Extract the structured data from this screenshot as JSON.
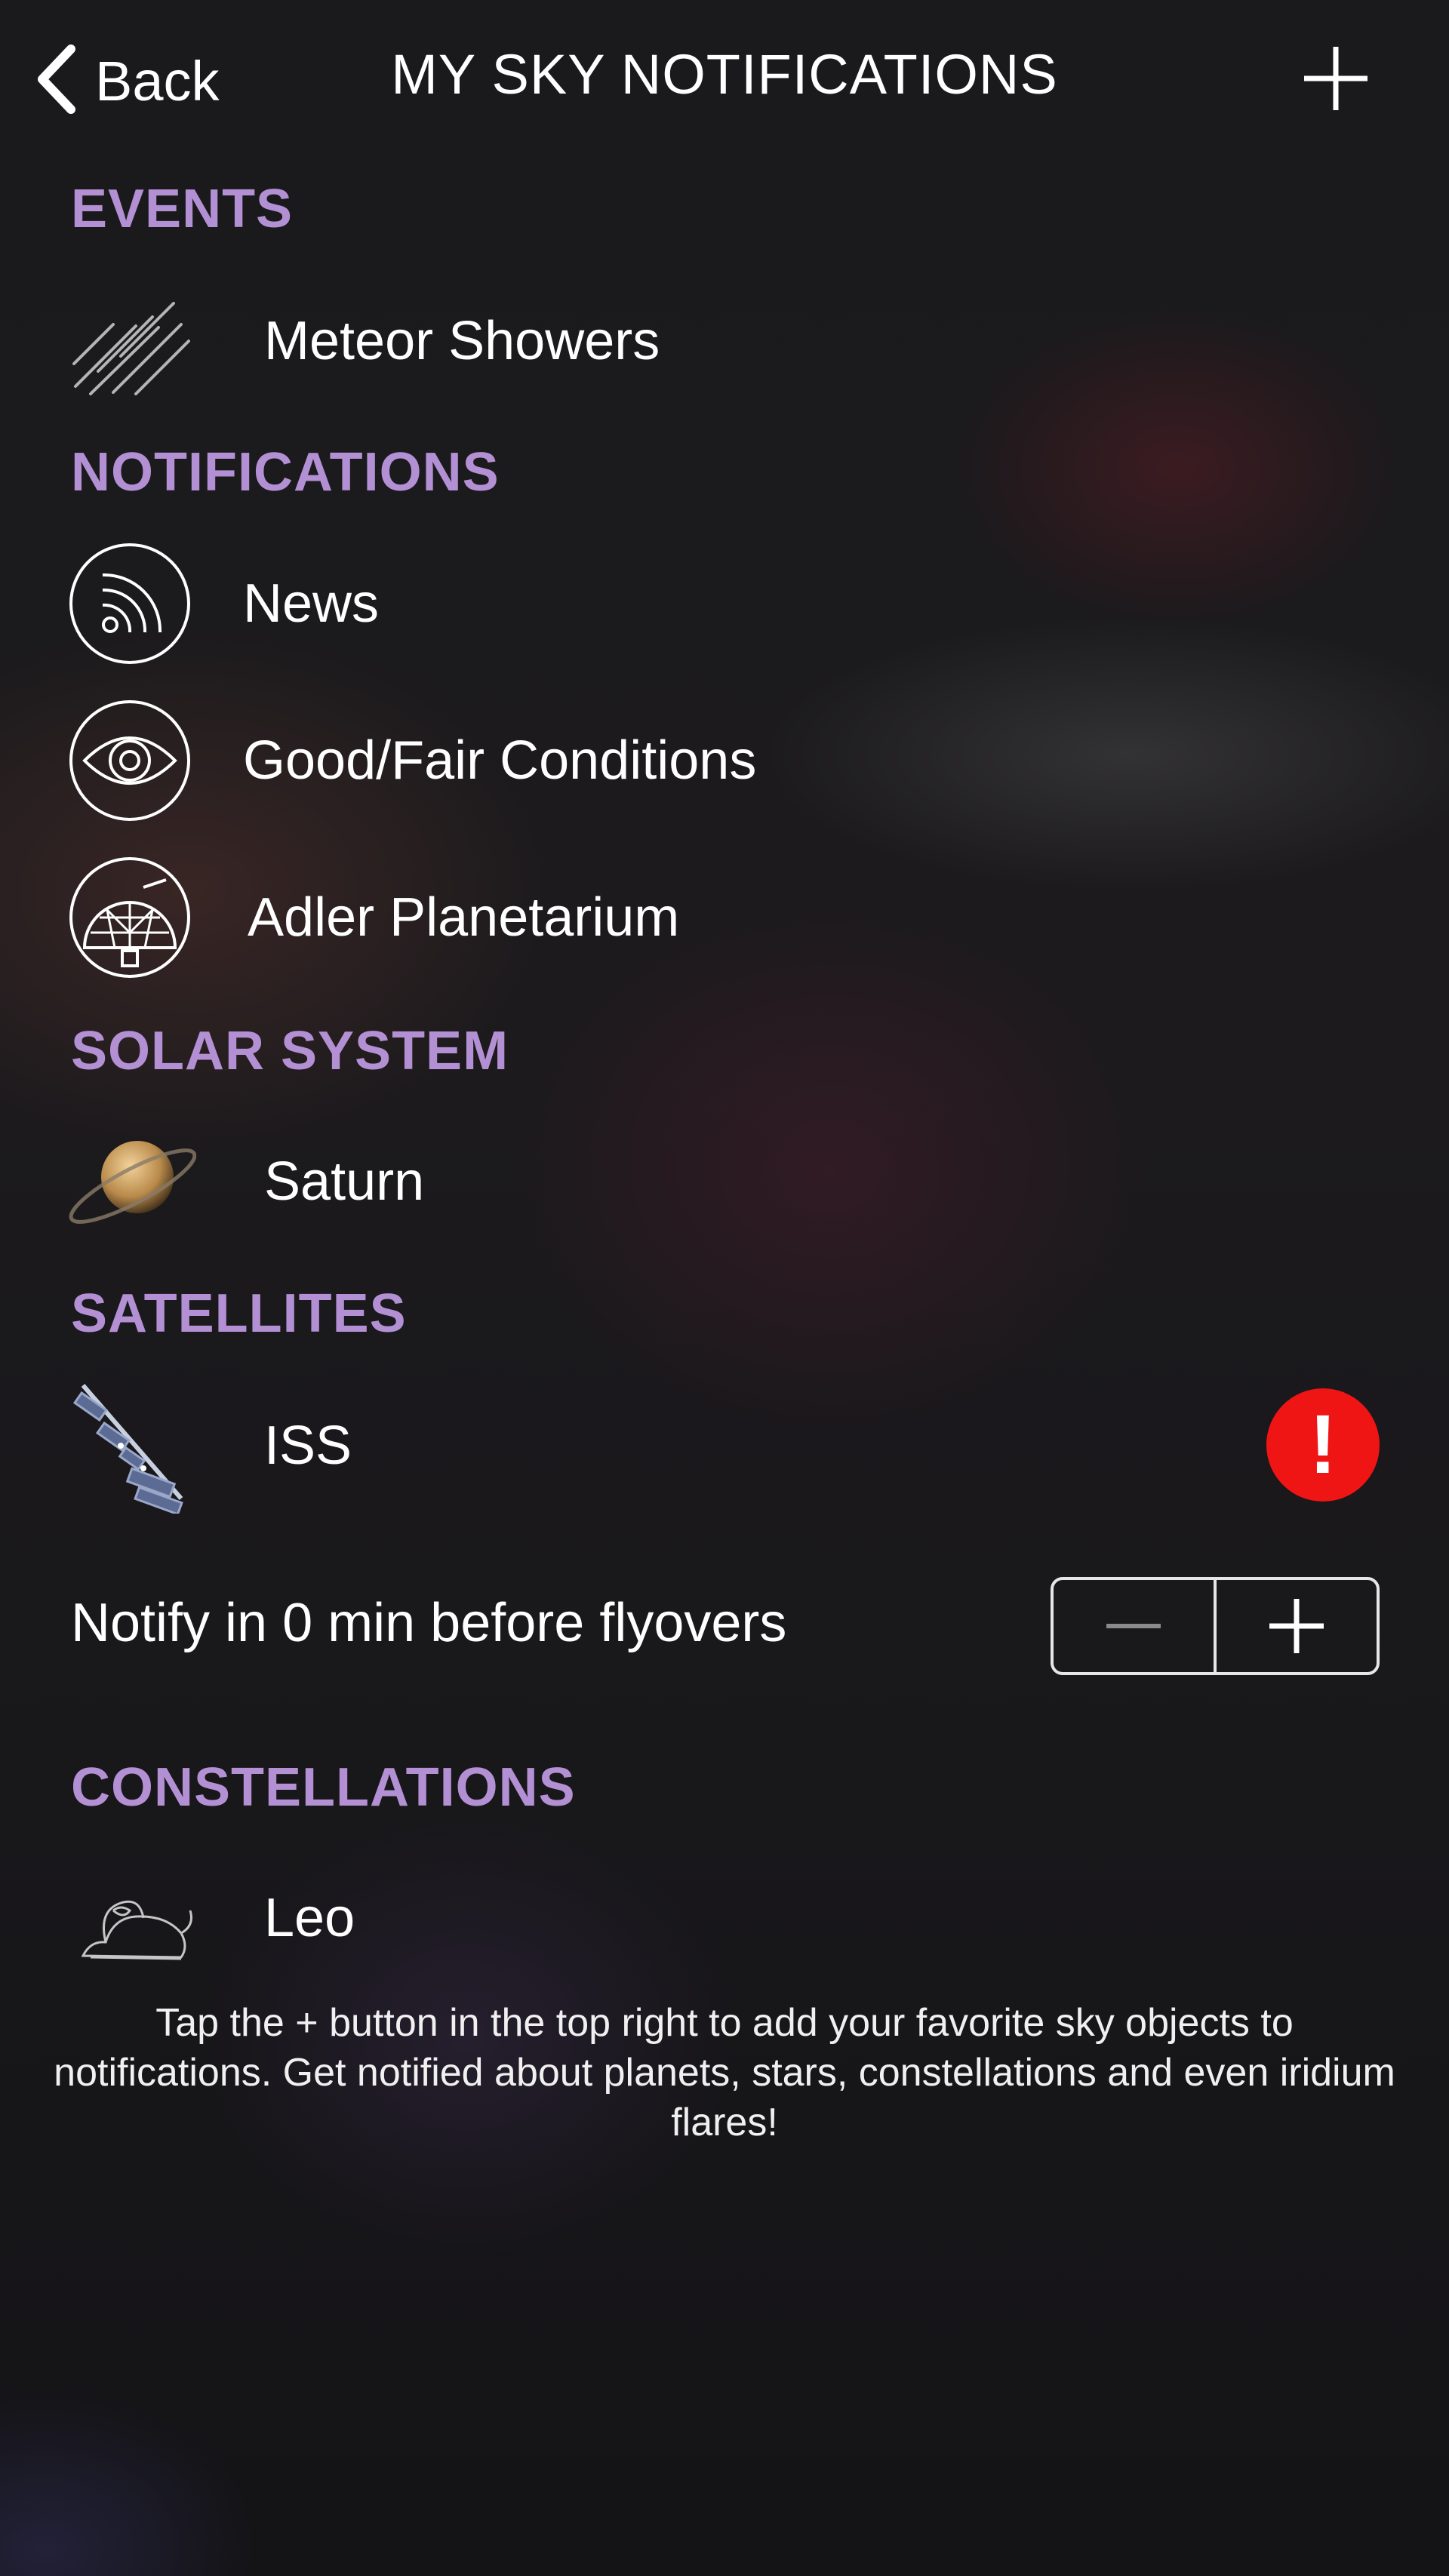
{
  "header": {
    "back_label": "Back",
    "title": "MY SKY NOTIFICATIONS",
    "add_icon": "plus-icon"
  },
  "sections": {
    "events": {
      "heading": "EVENTS",
      "items": [
        {
          "label": "Meteor Showers",
          "icon": "meteor-showers-icon"
        }
      ]
    },
    "notifications": {
      "heading": "NOTIFICATIONS",
      "items": [
        {
          "label": "News",
          "icon": "rss-icon"
        },
        {
          "label": "Good/Fair Conditions",
          "icon": "eye-icon"
        },
        {
          "label": "Adler Planetarium",
          "icon": "planetarium-dome-icon"
        }
      ]
    },
    "solar_system": {
      "heading": "SOLAR SYSTEM",
      "items": [
        {
          "label": "Saturn",
          "icon": "saturn-icon"
        }
      ]
    },
    "satellites": {
      "heading": "SATELLITES",
      "items": [
        {
          "label": "ISS",
          "icon": "iss-icon",
          "alert": "!"
        }
      ]
    },
    "constellations": {
      "heading": "CONSTELLATIONS",
      "items": [
        {
          "label": "Leo",
          "icon": "leo-constellation-icon"
        }
      ]
    }
  },
  "flyover": {
    "text": "Notify in 0 min before flyovers",
    "minutes": 0,
    "decrement_icon": "minus-icon",
    "increment_icon": "plus-icon"
  },
  "footer_hint": "Tap the + button in the top right to add your favorite sky objects to notifications. Get notified about planets, stars, constellations and even iridium flares!",
  "colors": {
    "section_heading": "#b390d4",
    "alert": "#f01515",
    "text": "#ffffff"
  }
}
